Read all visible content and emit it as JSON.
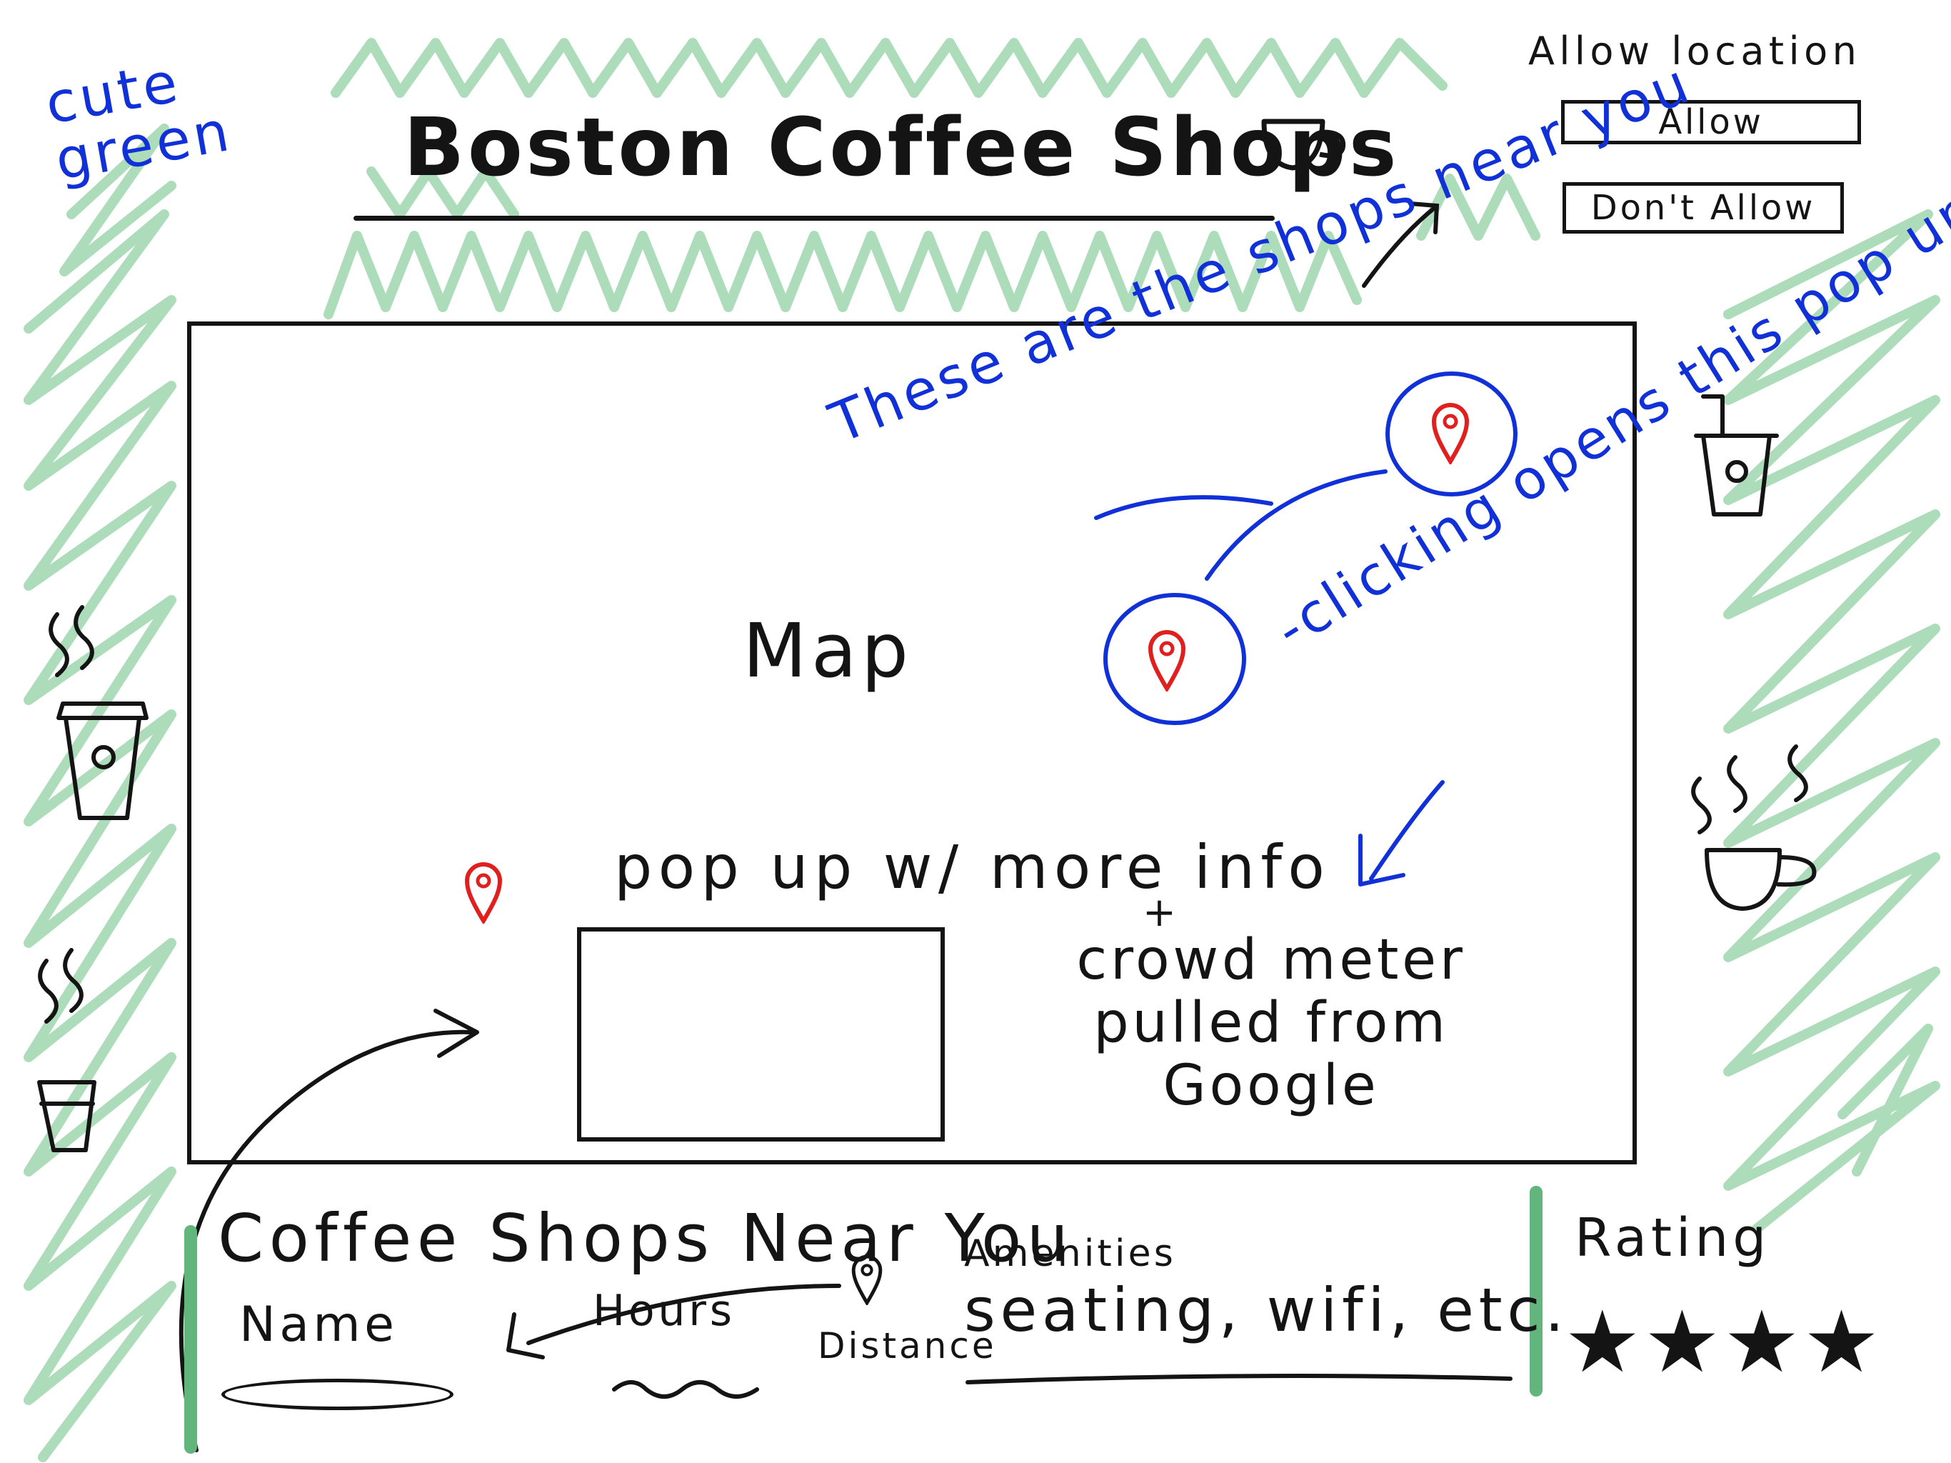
{
  "note": {
    "text": "cute green"
  },
  "header": {
    "title": "Boston Coffee Shops",
    "icon": "coffee-cup-icon"
  },
  "location": {
    "prompt": "Allow location",
    "allow_label": "Allow",
    "dont_allow_label": "Don't Allow"
  },
  "map": {
    "label": "Map",
    "annotation_shops": "These are the shops near you",
    "annotation_click": "-clicking opens this pop up",
    "popup_label": "pop up w/ more info",
    "plus": "+",
    "crowd_note": "crowd meter pulled from Google"
  },
  "list": {
    "title": "Coffee Shops Near You",
    "name_header": "Name",
    "hours_header": "Hours",
    "distance_header": "Distance",
    "amenities_header": "Amenities",
    "amenities_value": "seating, wifi, etc.",
    "rating_header": "Rating",
    "rating_value": "★★★★",
    "rating_stars": 4
  },
  "colors": {
    "accent_green": "#63b57e",
    "scribble_green": "#9fd6ae",
    "annotation_blue": "#1030d8",
    "pin_red": "#e0201e",
    "ink": "#141414"
  }
}
